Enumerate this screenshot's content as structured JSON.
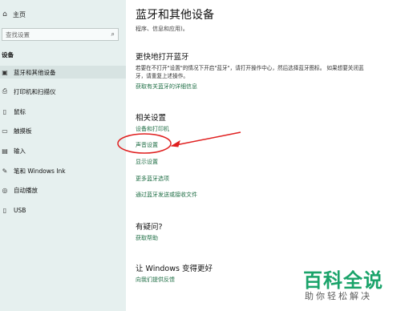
{
  "sidebar": {
    "home": {
      "icon": "home-icon",
      "label": "主页"
    },
    "search_placeholder": "查找设置",
    "section": "设备",
    "items": [
      {
        "icon": "bluetooth-devices-icon",
        "label": "蓝牙和其他设备"
      },
      {
        "icon": "printer-icon",
        "label": "打印机和扫描仪"
      },
      {
        "icon": "mouse-icon",
        "label": "鼠标"
      },
      {
        "icon": "touchpad-icon",
        "label": "触摸板"
      },
      {
        "icon": "keyboard-icon",
        "label": "输入"
      },
      {
        "icon": "pen-icon",
        "label": "笔和 Windows Ink"
      },
      {
        "icon": "autoplay-icon",
        "label": "自动播放"
      },
      {
        "icon": "usb-icon",
        "label": "USB"
      }
    ]
  },
  "main": {
    "title": "蓝牙和其他设备",
    "subtitle": "程序、信息和应用)。",
    "quick_bt": {
      "heading": "更快地打开蓝牙",
      "desc_line1": "若要在不打开\"设置\"的情况下开启\"蓝牙\"，请打开操作中心，然后选择蓝牙图标。 如果想要关闭蓝",
      "desc_line2": "牙，请重复上述操作。",
      "link": "获取有关蓝牙的详细信息"
    },
    "related": {
      "heading": "相关设置",
      "links": [
        "设备和打印机",
        "声音设置",
        "显示设置",
        "更多蓝牙选项",
        "通过蓝牙发送或接收文件"
      ]
    },
    "question": {
      "heading": "有疑问?",
      "link": "获取帮助"
    },
    "improve": {
      "heading": "让 Windows 变得更好",
      "link": "向我们提供反馈"
    }
  },
  "watermark": {
    "big": "百科全说",
    "small": "助你轻松解决"
  },
  "colors": {
    "accent_link": "#1f6e45",
    "sidebar_bg": "#e6f0ef",
    "annotation": "#e02020",
    "watermark": "#1aa36a"
  }
}
